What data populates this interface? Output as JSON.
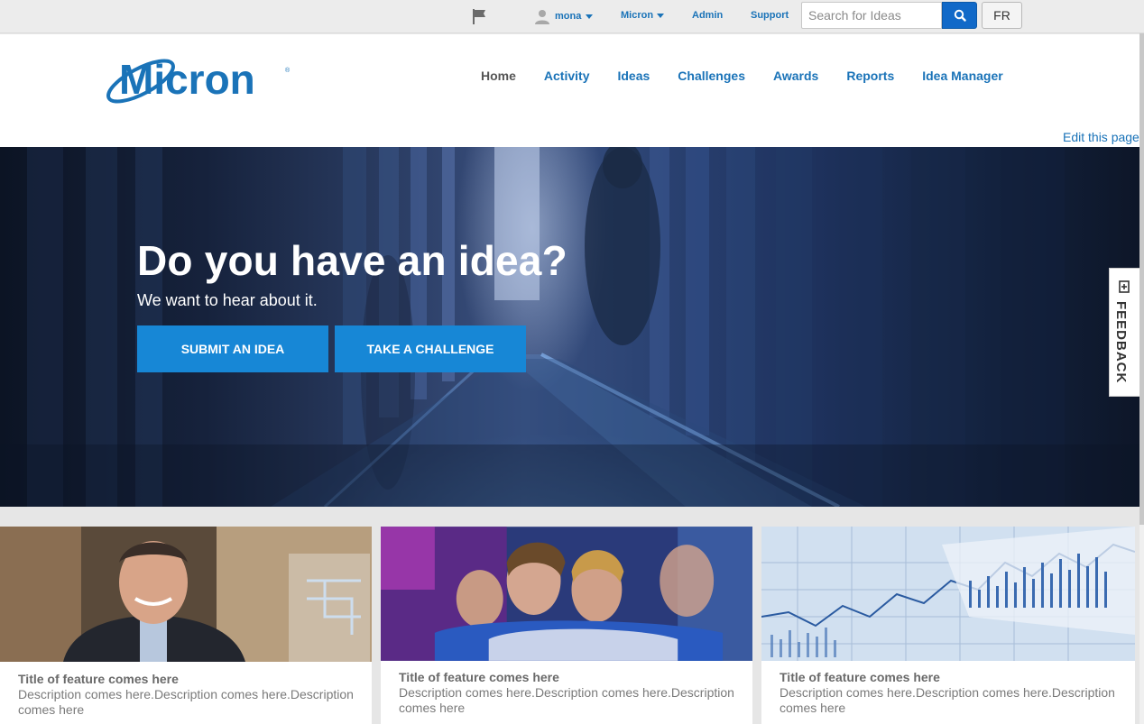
{
  "topbar": {
    "user_name": "mona",
    "org_label": "Micron",
    "admin_label": "Admin",
    "support_label": "Support",
    "search_placeholder": "Search for Ideas",
    "language_label": "FR"
  },
  "header": {
    "logo_text": "Micron",
    "nav": [
      "Home",
      "Activity",
      "Ideas",
      "Challenges",
      "Awards",
      "Reports",
      "Idea Manager"
    ],
    "active_nav": "Home",
    "edit_link": "Edit this page"
  },
  "hero": {
    "title": "Do you have an idea?",
    "subtitle": "We want to hear about it.",
    "submit_label": "SUBMIT AN IDEA",
    "challenge_label": "TAKE A CHALLENGE"
  },
  "feedback": {
    "label": "FEEDBACK"
  },
  "cards": [
    {
      "title": "Title of feature comes here",
      "description": "Description comes here.Description comes here.Description comes here"
    },
    {
      "title": "Title of feature comes here",
      "description": "Description comes here.Description comes here.Description comes here"
    },
    {
      "title": "Title of feature comes here",
      "description": "Description comes here.Description comes here.Description comes here"
    }
  ],
  "colors": {
    "brand_blue": "#1a73b8",
    "button_blue": "#1787d6",
    "search_blue": "#1169c8"
  },
  "icons": [
    "flag-icon",
    "user-avatar-icon",
    "chevron-down-icon",
    "search-icon",
    "feedback-icon"
  ]
}
